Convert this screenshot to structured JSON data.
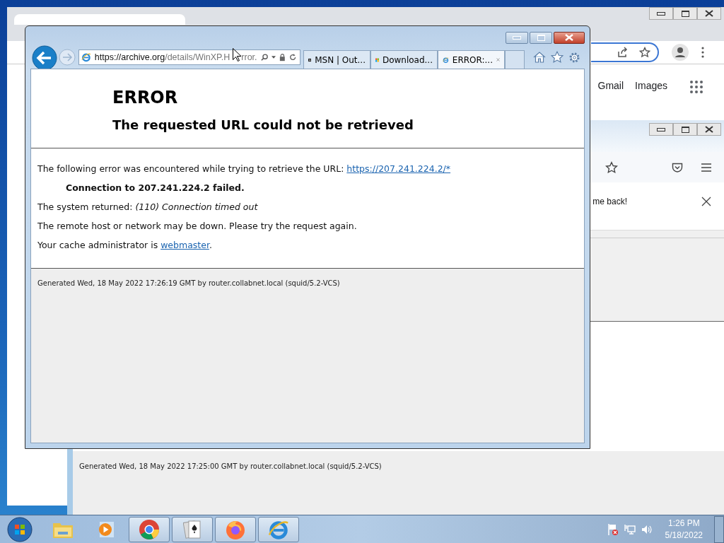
{
  "chrome_window": {
    "links": [
      "Gmail",
      "Images"
    ]
  },
  "firefox_window": {
    "notification": "me back!",
    "footer": "Generated Wed, 18 May 2022 17:25:00 GMT by router.collabnet.local (squid/5.2-VCS)"
  },
  "ie_window": {
    "address": {
      "host": "https://archive.org",
      "path": "/details/WinXP.H",
      "path_tail": "rror."
    },
    "tabs": [
      {
        "label": "MSN | Out...",
        "selected": false
      },
      {
        "label": "Download...",
        "selected": false
      },
      {
        "label": "ERROR:...",
        "selected": true
      }
    ],
    "page": {
      "heading": "ERROR",
      "subheading": "The requested URL could not be retrieved",
      "intro": "The following error was encountered while trying to retrieve the URL: ",
      "url_link": "https://207.241.224.2/*",
      "failure": "Connection to 207.241.224.2 failed.",
      "system": "The system returned: *(110) Connection timed out*",
      "remote": "The remote host or network may be down. Please try the request again.",
      "admin": "Your cache administrator is ",
      "admin_link": "webmaster",
      "admin_end": ".",
      "footer": "Generated Wed, 18 May 2022 17:26:19 GMT by router.collabnet.local (squid/5.2-VCS)"
    }
  },
  "taskbar": {
    "items": [
      {
        "kind": "explorer",
        "open": false
      },
      {
        "kind": "media",
        "open": false
      },
      {
        "kind": "chrome",
        "open": true
      },
      {
        "kind": "solitaire",
        "open": true
      },
      {
        "kind": "firefox",
        "open": true
      },
      {
        "kind": "ie",
        "open": true
      }
    ],
    "time": "1:26 PM",
    "date": "5/18/2022"
  }
}
